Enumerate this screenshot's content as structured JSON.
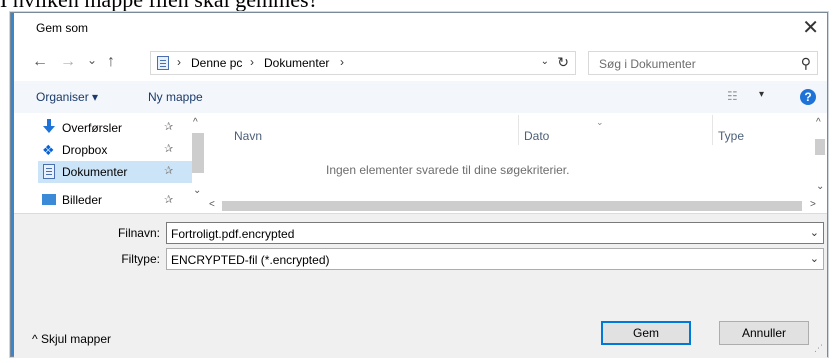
{
  "caption": "I hvilken mappe filen skal gemmes?",
  "window": {
    "title": "Gem som",
    "close_glyph": "✕"
  },
  "nav": {
    "back_glyph": "←",
    "forward_glyph": "→",
    "recent_glyph": "⌄",
    "up_glyph": "↑",
    "breadcrumb": [
      "Denne pc",
      "Dokumenter"
    ],
    "sep_glyph": "›",
    "dropdown_glyph": "⌄",
    "refresh_glyph": "↻",
    "search_placeholder": "Søg i Dokumenter",
    "search_glyph": "⚲"
  },
  "toolbar": {
    "organize_label": "Organiser ▾",
    "new_folder_label": "Ny mappe",
    "view_glyph": "☷",
    "view_dd_glyph": "▾",
    "help_label": "?"
  },
  "sidebar": {
    "items": [
      {
        "label": "Overførsler",
        "icon": "download-icon",
        "pin": "✰"
      },
      {
        "label": "Dropbox",
        "icon": "dropbox-icon",
        "pin": "✰"
      },
      {
        "label": "Dokumenter",
        "icon": "document-icon",
        "pin": "✰",
        "selected": true
      },
      {
        "label": "Billeder",
        "icon": "pictures-icon",
        "pin": "✰"
      }
    ],
    "scroll_up_glyph": "^",
    "scroll_down_glyph": "⌄"
  },
  "file_list": {
    "columns": [
      "Navn",
      "Dato",
      "Type"
    ],
    "sort_glyph": "⌄",
    "empty_message": "Ingen elementer svarede til dine søgekriterier.",
    "scroll_up_glyph": "^",
    "scroll_down_glyph": "⌄",
    "scroll_left_glyph": "<",
    "scroll_right_glyph": ">"
  },
  "form": {
    "filename_label": "Filnavn:",
    "filename_value": "Fortroligt.pdf.encrypted",
    "filetype_label": "Filtype:",
    "filetype_value": "ENCRYPTED-fil (*.encrypted)",
    "dd_glyph": "⌄",
    "hide_folders_label": "^  Skjul mapper",
    "save_label": "Gem",
    "cancel_label": "Annuller",
    "grip_glyph": "⋰"
  },
  "colors": {
    "accent": "#0078d7",
    "selection": "#cce4f7",
    "help": "#1e73d8"
  }
}
